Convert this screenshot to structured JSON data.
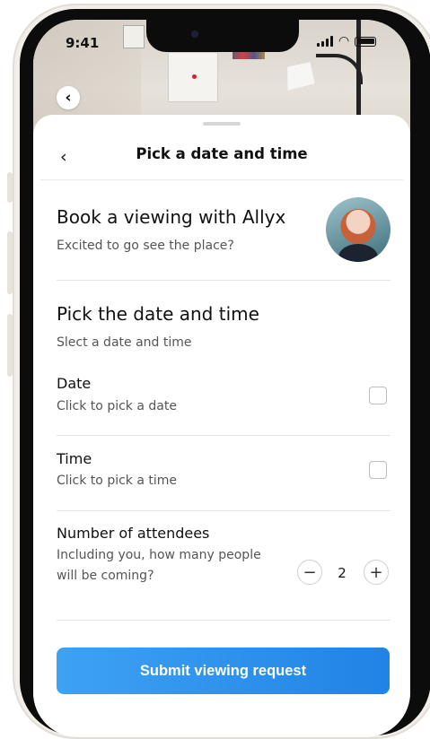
{
  "status_bar": {
    "time": "9:41"
  },
  "header": {
    "back_icon": "chevron-left",
    "title": "Pick a date and time"
  },
  "host": {
    "title": "Book a viewing with Allyx",
    "subtitle": "Excited to go see the place?"
  },
  "section": {
    "title": "Pick the date and time",
    "subtitle": "Slect a date and time"
  },
  "date_row": {
    "label": "Date",
    "help": "Click to pick a date"
  },
  "time_row": {
    "label": "Time",
    "help": "Click to pick a time"
  },
  "attendees_row": {
    "label": "Number of attendees",
    "help_line1": "Including you, how many people",
    "help_line2": "will be coming?",
    "value": "2",
    "decrement_symbol": "−",
    "increment_symbol": "+"
  },
  "submit_button": {
    "label": "Submit viewing request"
  },
  "colors": {
    "accent": "#2f93ee",
    "text": "#111111",
    "muted": "#555555"
  }
}
